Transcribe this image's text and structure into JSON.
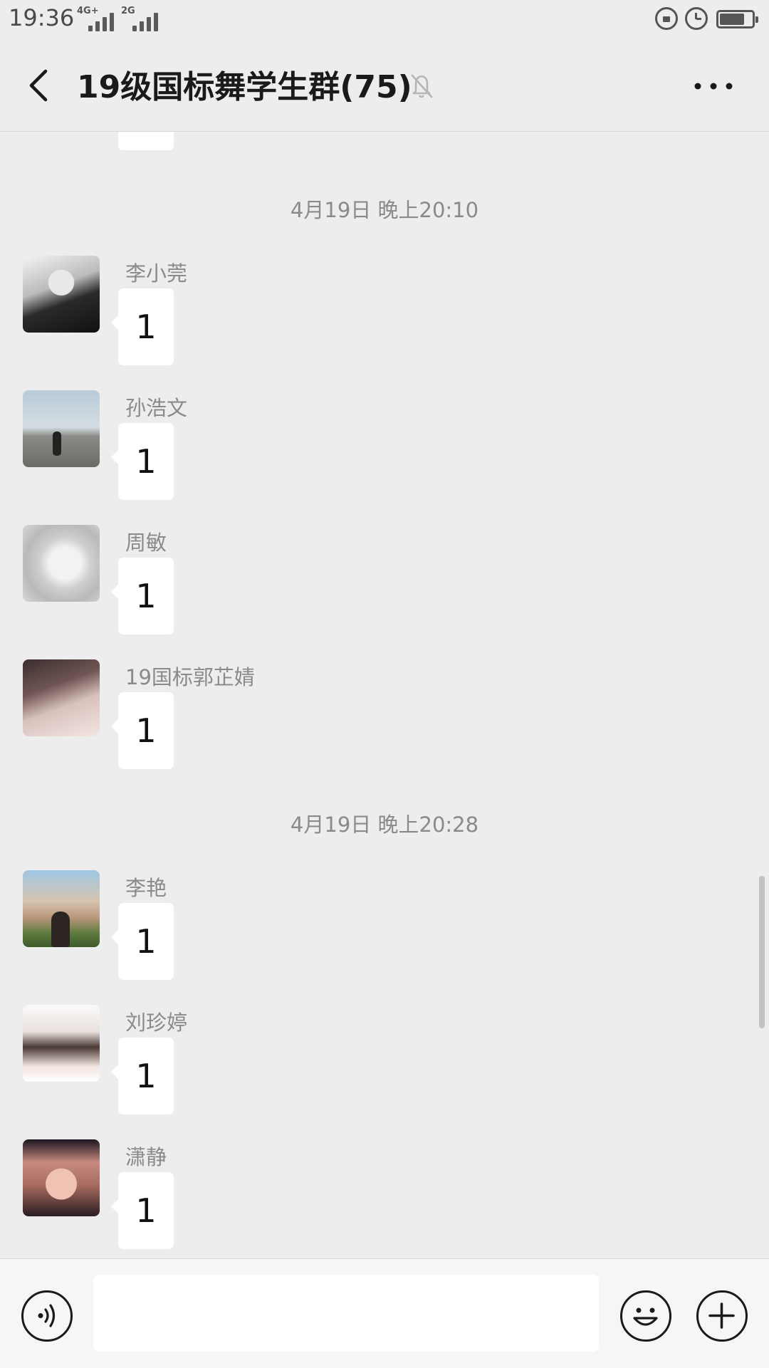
{
  "status_bar": {
    "time": "19:36",
    "signal1_label": "4G+",
    "signal2_label": "2G"
  },
  "header": {
    "title": "19级国标舞学生群(75)"
  },
  "chat": {
    "timestamps": [
      "4月19日 晚上20:10",
      "4月19日 晚上20:28"
    ],
    "messages": [
      {
        "sender": "李小莞",
        "text": "1"
      },
      {
        "sender": "孙浩文",
        "text": "1"
      },
      {
        "sender": "周敏",
        "text": "1"
      },
      {
        "sender": "19国标郭芷婧",
        "text": "1"
      },
      {
        "sender": "李艳",
        "text": "1"
      },
      {
        "sender": "刘珍婷",
        "text": "1"
      },
      {
        "sender": "潇静",
        "text": "1"
      }
    ]
  },
  "input_bar": {
    "placeholder": ""
  },
  "icons": {
    "back": "chevron-left-icon",
    "mute": "bell-off-icon",
    "more": "more-horizontal-icon",
    "voice": "voice-icon",
    "emoji": "emoji-icon",
    "plus": "plus-icon"
  }
}
